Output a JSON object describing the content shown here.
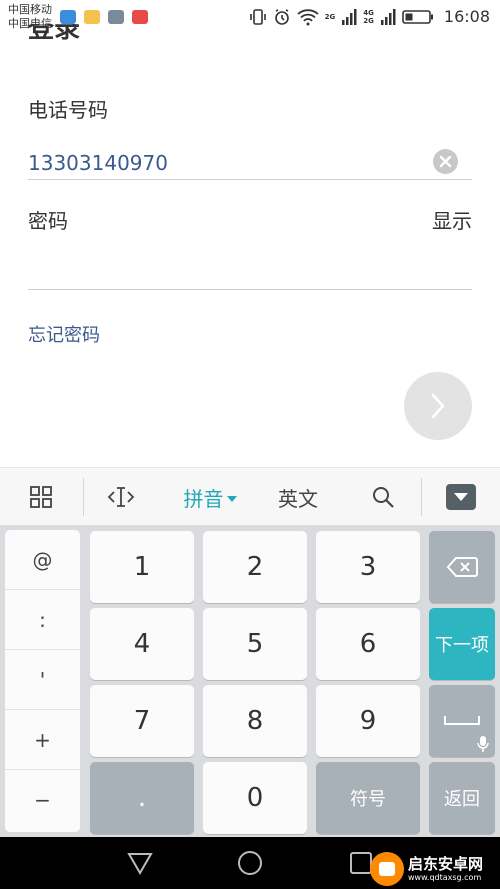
{
  "status_bar": {
    "carrier1": "中国移动",
    "carrier2": "中国电信",
    "network_a": "2G",
    "network_b": "4G",
    "network_c": "2G",
    "time": "16:08"
  },
  "page": {
    "title_fragment": "登录"
  },
  "form": {
    "phone_label": "电话号码",
    "phone_value": "13303140970",
    "password_label": "密码",
    "show_label": "显示",
    "forgot_label": "忘记密码"
  },
  "keyboard_toolbar": {
    "pinyin": "拼音",
    "english": "英文"
  },
  "keyboard": {
    "symbols": [
      "@",
      ":",
      "'",
      "+",
      "−"
    ],
    "digits": [
      "1",
      "2",
      "3",
      "4",
      "5",
      "6",
      "7",
      "8",
      "9",
      "0"
    ],
    "dot": ".",
    "symbol_key": "符号",
    "next_item": "下一项",
    "return_key": "返回"
  },
  "watermark": {
    "name": "启东安卓网",
    "url": "www.qdtaxsg.com"
  },
  "colors": {
    "accent": "#2db5c2",
    "link": "#3a5a8c",
    "key_dark": "#a8b0b8"
  }
}
